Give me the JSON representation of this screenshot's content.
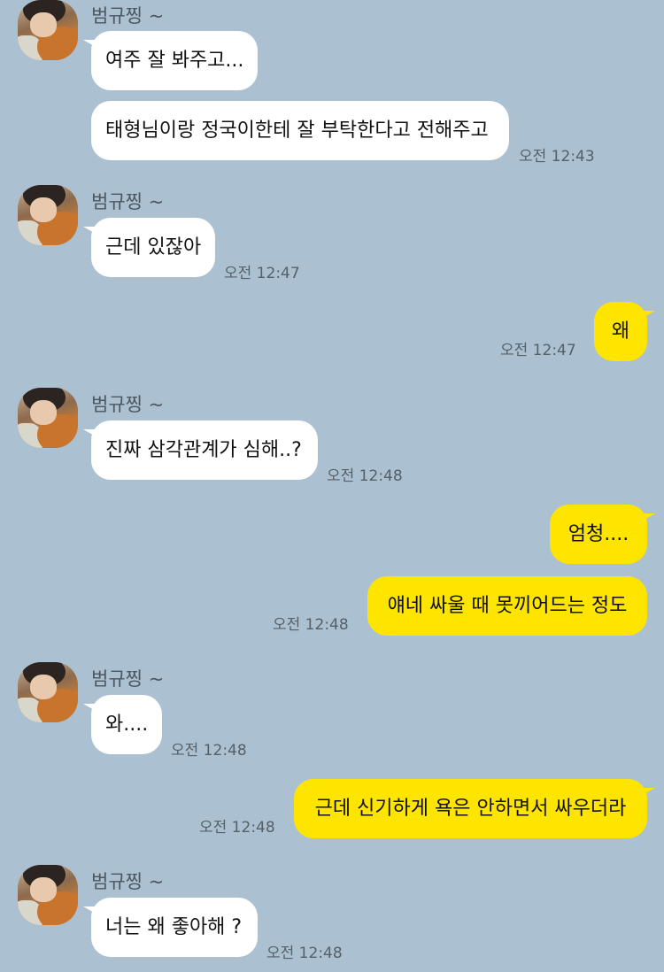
{
  "chat": {
    "sender_name": "범규찡 ~",
    "messages": [
      {
        "text": "여주 잘 봐주고...",
        "time": ""
      },
      {
        "text": "태형님이랑 정국이한테 잘 부탁한다고 전해주고",
        "time": "오전 12:43"
      },
      {
        "text": "근데 있잖아",
        "time": "오전 12:47"
      },
      {
        "text": "왜",
        "time": "오전 12:47"
      },
      {
        "text": "진짜 삼각관계가 심해..?",
        "time": "오전 12:48"
      },
      {
        "text": "엄청....",
        "time": ""
      },
      {
        "text": "얘네 싸울 때 못끼어드는 정도",
        "time": "오전 12:48"
      },
      {
        "text": "와....",
        "time": "오전 12:48"
      },
      {
        "text": "근데 신기하게 욕은 안하면서 싸우더라",
        "time": "오전 12:48"
      },
      {
        "text": "너는 왜 좋아해 ?",
        "time": "오전 12:48"
      }
    ]
  },
  "colors": {
    "background": "#abc1d1",
    "incoming_bubble": "#ffffff",
    "outgoing_bubble": "#fee500"
  }
}
